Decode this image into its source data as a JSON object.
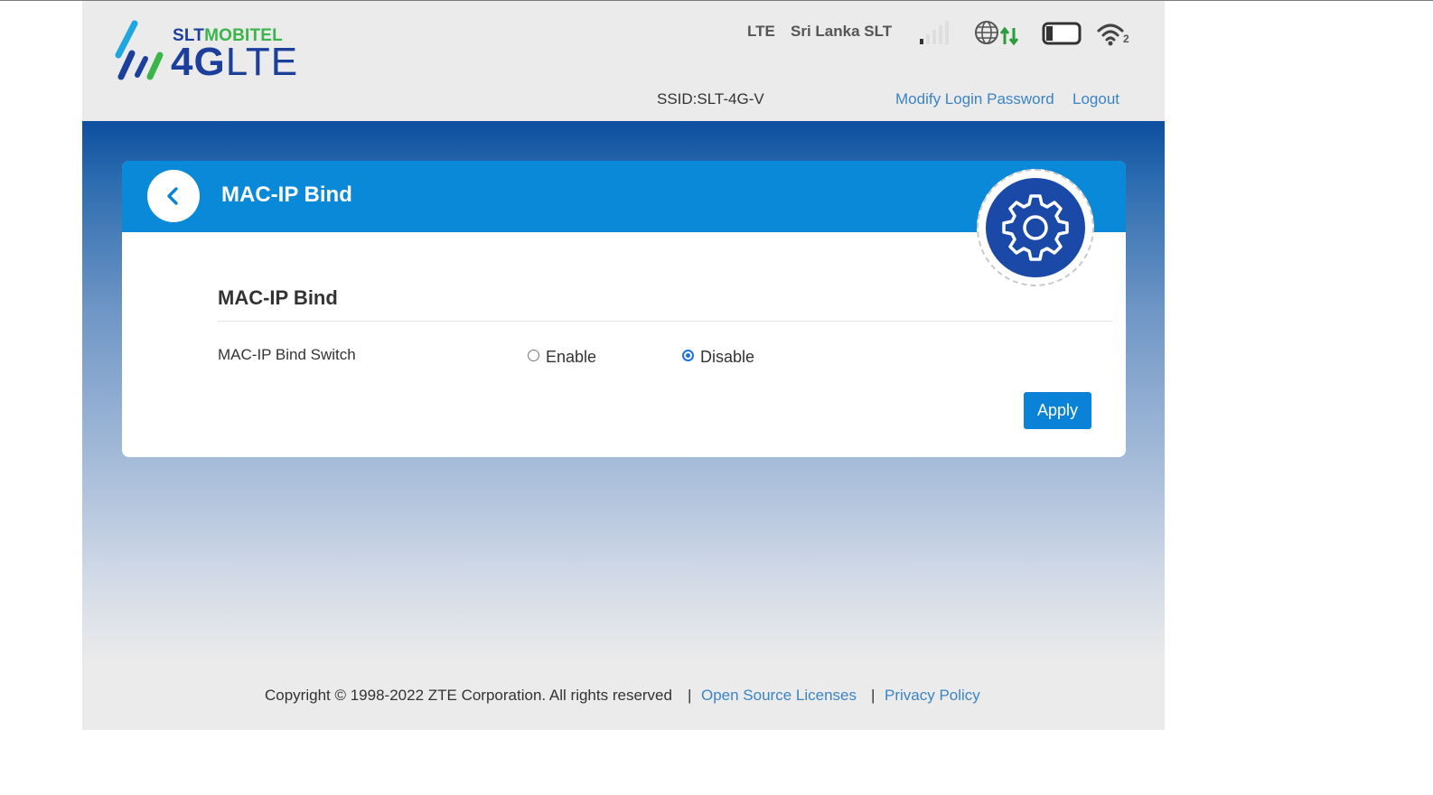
{
  "header": {
    "logo": {
      "brand_part1": "SLT",
      "brand_part2": "MOBITEL",
      "product_bold": "4G",
      "product_light": "LTE"
    },
    "network_type": "LTE",
    "carrier": "Sri Lanka SLT",
    "signal_icon": "signal-bars-icon",
    "internet_icon": "globe-data-icon",
    "battery_icon": "battery-icon",
    "wifi_icon": "wifi-icon",
    "wifi_clients": "2",
    "ssid": "SSID:SLT-4G-V",
    "modify_password_label": "Modify Login Password",
    "logout_label": "Logout"
  },
  "card": {
    "title": "MAC-IP Bind",
    "section_title": "MAC-IP Bind",
    "switch_label": "MAC-IP Bind Switch",
    "options": [
      {
        "label": "Enable",
        "selected": false
      },
      {
        "label": "Disable",
        "selected": true
      }
    ],
    "apply_label": "Apply"
  },
  "footer": {
    "copyright": "Copyright © 1998-2022 ZTE Corporation. All rights reserved",
    "separator": "|",
    "open_source_label": "Open Source Licenses",
    "privacy_label": "Privacy Policy"
  },
  "colors": {
    "header_bg": "#ebebeb",
    "brand_blue": "#1b3f9b",
    "brand_green": "#39b54a",
    "card_header": "#0a89d8",
    "link": "#3b84c4",
    "button": "#0a82d8",
    "gear_disc": "#1b49a8"
  }
}
